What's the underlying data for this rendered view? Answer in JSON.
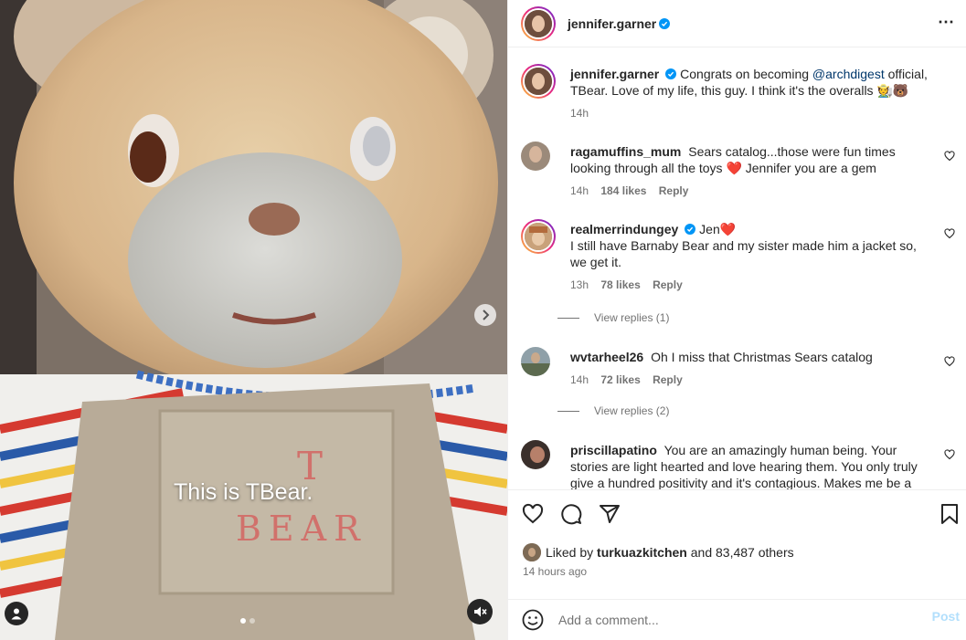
{
  "media": {
    "caption": "This is TBear.",
    "embroidery_line1": "T",
    "embroidery_line2": "BEAR"
  },
  "post": {
    "author": "jennifer.garner",
    "caption_text": "Congrats on becoming",
    "mention": "@archdigest",
    "caption_rest": "official, TBear. Love of my life, this guy. I think it's the overalls 🧑‍🌾🐻",
    "time": "14h"
  },
  "comments": [
    {
      "user": "ragamuffins_mum",
      "text": "Sears catalog...those were fun times looking through all the toys ❤️ Jennifer you are a gem",
      "time": "14h",
      "likes": "184 likes",
      "reply": "Reply"
    },
    {
      "user": "realmerrindungey",
      "text": "Jen❤️\nI still have Barnaby Bear and my sister made him a jacket so, we get it.",
      "time": "13h",
      "likes": "78 likes",
      "reply": "Reply",
      "view_replies": "View replies (1)"
    },
    {
      "user": "wvtarheel26",
      "text": "Oh I miss that Christmas Sears catalog",
      "time": "14h",
      "likes": "72 likes",
      "reply": "Reply",
      "view_replies": "View replies (2)"
    },
    {
      "user": "priscillapatino",
      "text": "You are an amazingly human being. Your stories are light hearted and love hearing them. You only truly give a hundred positivity and it's contagious. Makes me be a better"
    }
  ],
  "likes": {
    "prefix": "Liked by",
    "user": "turkuazkitchen",
    "suffix": "and 83,487 others"
  },
  "posted_ago": "14 hours ago",
  "add_comment": {
    "placeholder": "Add a comment...",
    "post_label": "Post"
  },
  "colors": {
    "link": "#00376b",
    "verified": "#0095f6",
    "post_disabled": "#b2dffc"
  }
}
